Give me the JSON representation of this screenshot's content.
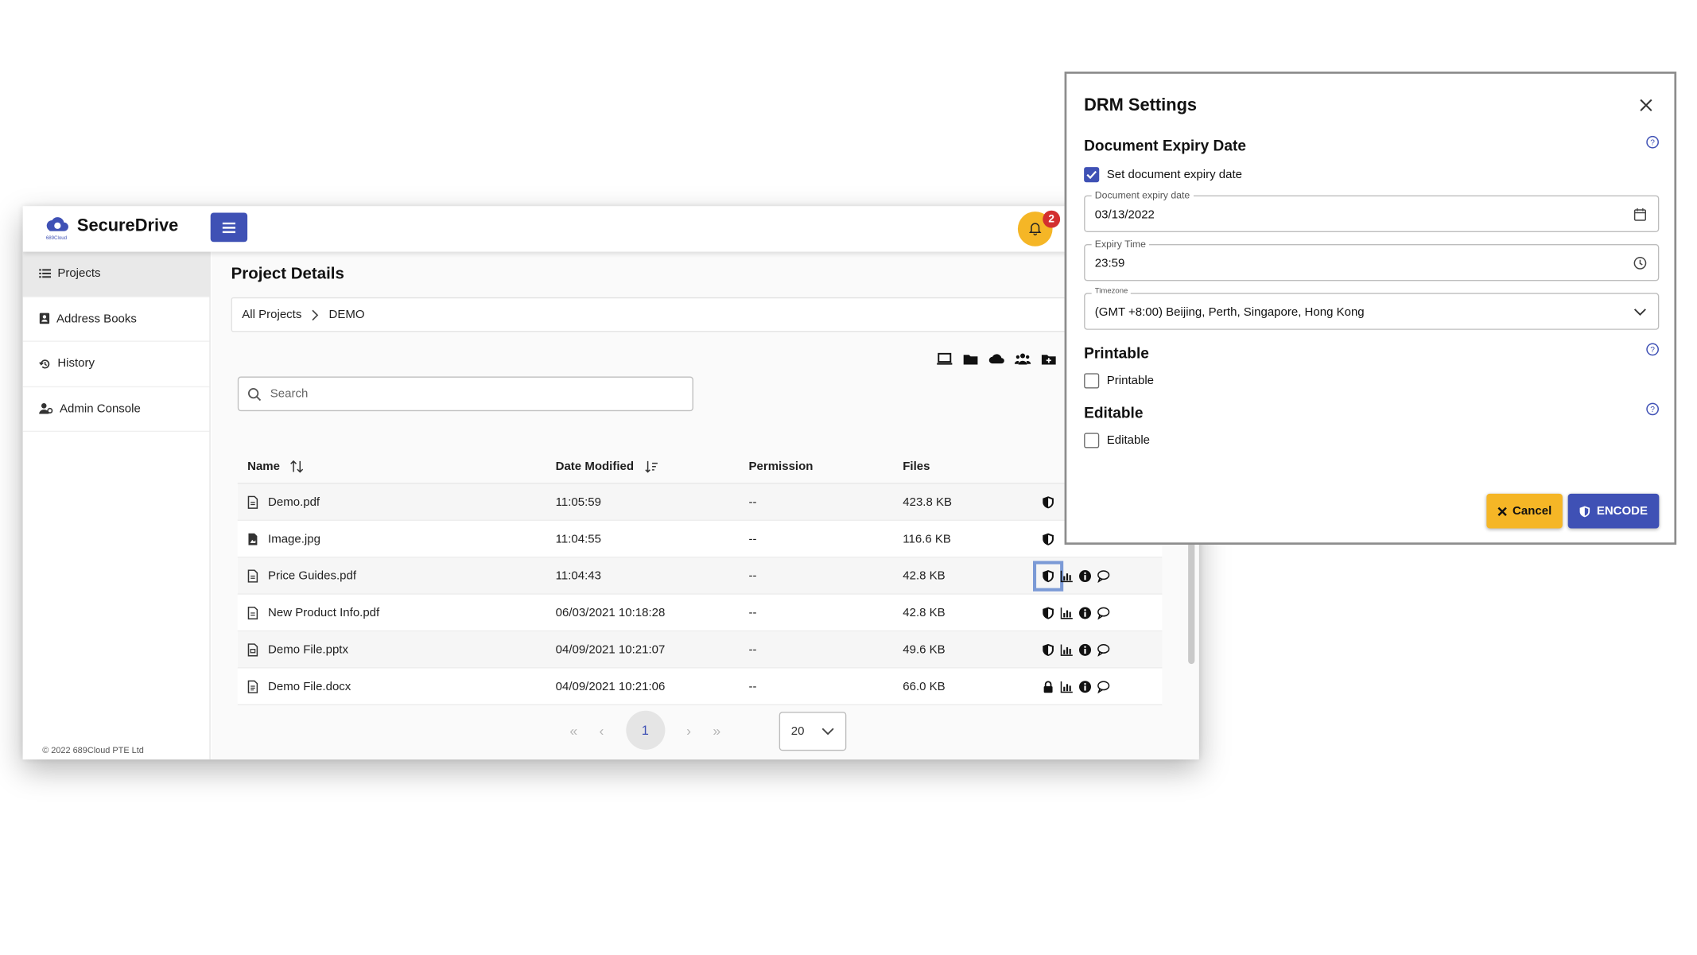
{
  "app": {
    "brand": "SecureDrive",
    "logo_text": "689Cloud",
    "notification_count": "2"
  },
  "sidebar": {
    "items": [
      {
        "label": "Projects",
        "icon": "list-icon"
      },
      {
        "label": "Address Books",
        "icon": "address-book-icon"
      },
      {
        "label": "History",
        "icon": "history-icon"
      },
      {
        "label": "Admin Console",
        "icon": "admin-icon"
      }
    ],
    "copyright": "© 2022 689Cloud PTE Ltd"
  },
  "main": {
    "title": "Project Details",
    "breadcrumb": [
      "All Projects",
      "DEMO"
    ],
    "search_placeholder": "Search",
    "columns": [
      "Name",
      "Date Modified",
      "Permission",
      "Files"
    ],
    "rows": [
      {
        "name": "Demo.pdf",
        "date": "11:05:59",
        "permission": "--",
        "size": "423.8 KB"
      },
      {
        "name": "Image.jpg",
        "date": "11:04:55",
        "permission": "--",
        "size": "116.6 KB"
      },
      {
        "name": "Price Guides.pdf",
        "date": "11:04:43",
        "permission": "--",
        "size": "42.8 KB"
      },
      {
        "name": "New Product Info.pdf",
        "date": "06/03/2021 10:18:28",
        "permission": "--",
        "size": "42.8 KB"
      },
      {
        "name": "Demo File.pptx",
        "date": "04/09/2021 10:21:07",
        "permission": "--",
        "size": "49.6 KB"
      },
      {
        "name": "Demo File.docx",
        "date": "04/09/2021 10:21:06",
        "permission": "--",
        "size": "66.0 KB"
      }
    ],
    "pagination": {
      "current": "1",
      "page_size": "20"
    }
  },
  "modal": {
    "title": "DRM Settings",
    "expiry_section": "Document Expiry Date",
    "expiry_checkbox": "Set document expiry date",
    "expiry_checked": true,
    "date_label": "Document expiry date",
    "date_value": "03/13/2022",
    "time_label": "Expiry Time",
    "time_value": "23:59",
    "tz_label": "Timezone",
    "tz_value": "(GMT +8:00) Beijing, Perth, Singapore, Hong Kong",
    "printable_section": "Printable",
    "printable_checkbox": "Printable",
    "editable_section": "Editable",
    "editable_checkbox": "Editable",
    "cancel_label": "Cancel",
    "encode_label": "ENCODE"
  },
  "colors": {
    "primary": "#3f51b5",
    "warning": "#f5b626",
    "badge": "#d32f2f"
  }
}
